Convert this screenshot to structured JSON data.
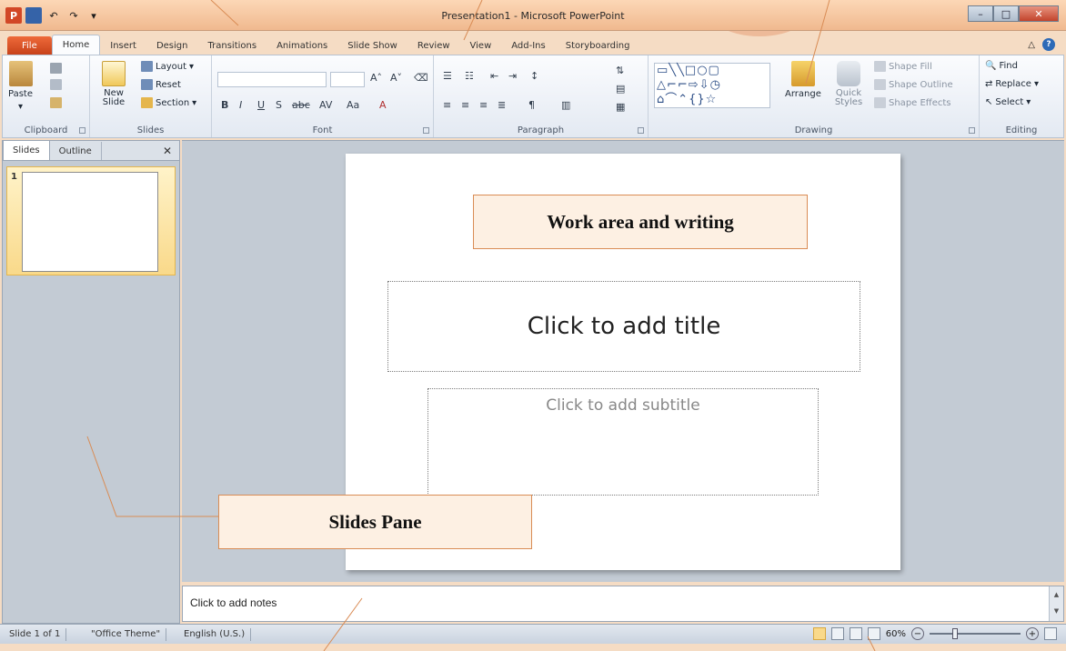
{
  "window": {
    "title": "Presentation1 - Microsoft PowerPoint"
  },
  "tabs": [
    "File",
    "Home",
    "Insert",
    "Design",
    "Transitions",
    "Animations",
    "Slide Show",
    "Review",
    "View",
    "Add-Ins",
    "Storyboarding"
  ],
  "ribbon": {
    "clipboard": {
      "label": "Clipboard",
      "paste": "Paste"
    },
    "slides": {
      "label": "Slides",
      "new_slide": "New Slide",
      "layout": "Layout",
      "reset": "Reset",
      "section": "Section"
    },
    "font": {
      "label": "Font"
    },
    "paragraph": {
      "label": "Paragraph"
    },
    "drawing": {
      "label": "Drawing",
      "arrange": "Arrange",
      "quick_styles": "Quick Styles",
      "shape_fill": "Shape Fill",
      "shape_outline": "Shape Outline",
      "shape_effects": "Shape Effects"
    },
    "editing": {
      "label": "Editing",
      "find": "Find",
      "replace": "Replace",
      "select": "Select"
    }
  },
  "slides_pane": {
    "tabs": [
      "Slides",
      "Outline"
    ],
    "thumbnail_number": "1"
  },
  "slide": {
    "title_placeholder": "Click to add title",
    "subtitle_placeholder": "Click to add subtitle"
  },
  "notes": {
    "placeholder": "Click to add notes"
  },
  "status": {
    "slide_info": "Slide 1 of 1",
    "theme": "\"Office Theme\"",
    "language": "English (U.S.)",
    "zoom": "60%",
    "zoom_level_percent": 60
  },
  "annotations": {
    "work_area": "Work area and writing",
    "slides_pane": "Slides Pane"
  },
  "colors": {
    "file_tab": "#d24726",
    "accent_frame": "#d98c55"
  }
}
